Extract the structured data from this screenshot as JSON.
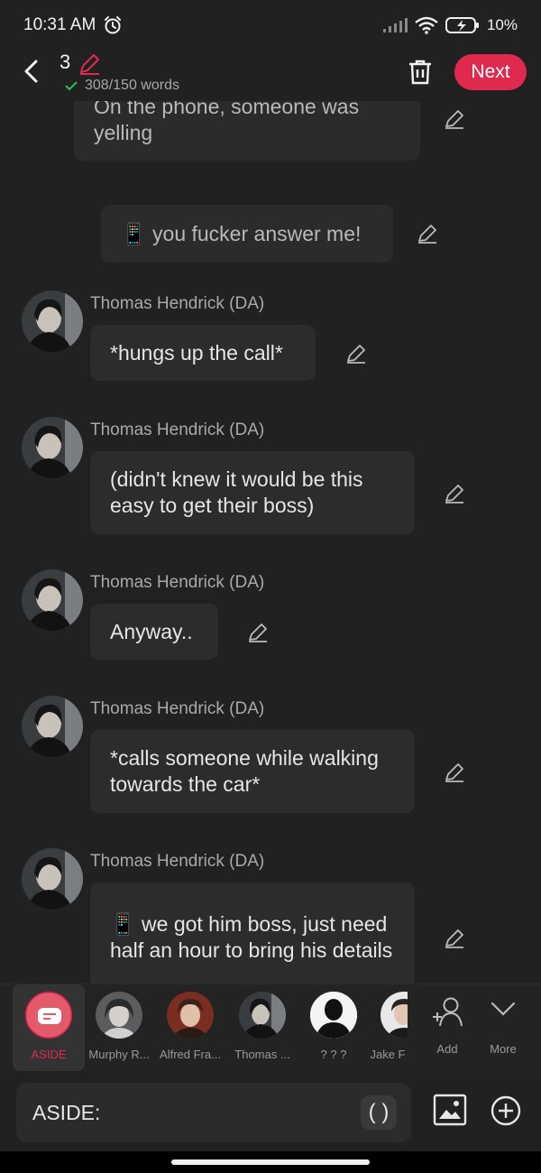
{
  "status": {
    "time": "10:31 AM",
    "battery": "10%"
  },
  "header": {
    "number": "3",
    "word_count": "308/150 words",
    "next_label": "Next"
  },
  "messages": [
    {
      "type": "narration",
      "text": "On the phone, someone was yelling"
    },
    {
      "type": "narration",
      "text": "📱 you fucker answer me!"
    },
    {
      "type": "character",
      "name": "Thomas Hendrick (DA)",
      "text": "*hungs up the call*"
    },
    {
      "type": "character",
      "name": "Thomas Hendrick (DA)",
      "text": "(didn't knew it would be this easy to get their boss)"
    },
    {
      "type": "character",
      "name": "Thomas Hendrick (DA)",
      "text": "Anyway.."
    },
    {
      "type": "character",
      "name": "Thomas Hendrick (DA)",
      "text": "*calls someone while walking towards the car*"
    },
    {
      "type": "character",
      "name": "Thomas Hendrick (DA)",
      "text": "📱 we got him boss, just need half an hour to bring his details"
    }
  ],
  "characters": [
    {
      "label": "ASIDE",
      "active": true
    },
    {
      "label": "Murphy R..."
    },
    {
      "label": "Alfred Fra..."
    },
    {
      "label": "Thomas ..."
    },
    {
      "label": "? ? ?"
    },
    {
      "label": "Jake F"
    },
    {
      "label": "Add"
    },
    {
      "label": "More"
    }
  ],
  "input": {
    "prefix": "ASIDE:",
    "paren": "( )"
  }
}
